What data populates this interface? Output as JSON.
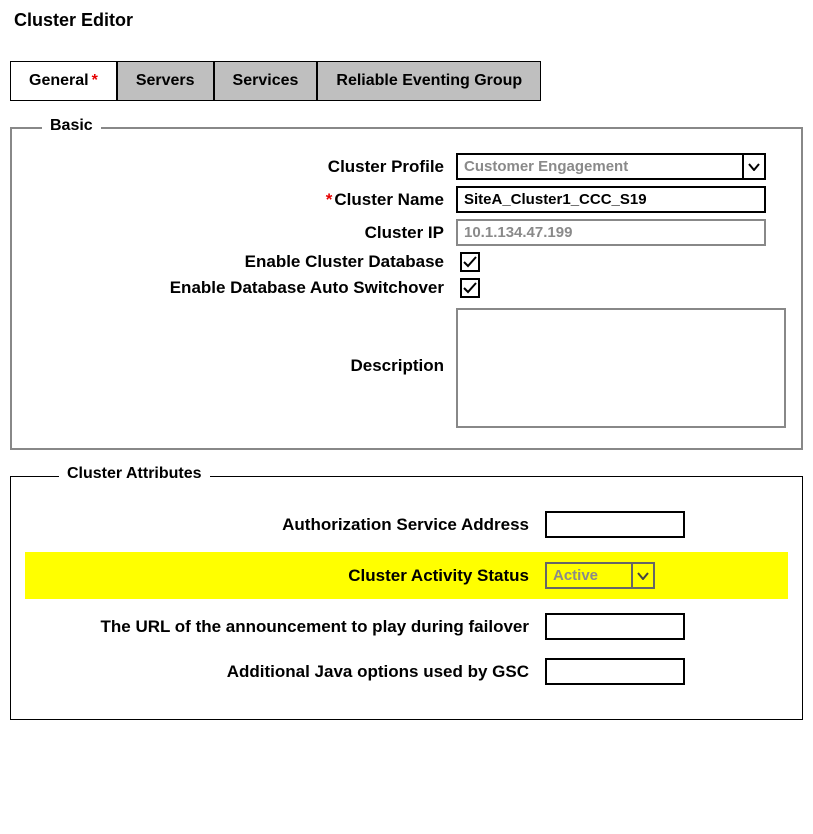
{
  "title": "Cluster Editor",
  "tabs": [
    {
      "label": "General",
      "required": true,
      "active": true
    },
    {
      "label": "Servers",
      "required": false,
      "active": false
    },
    {
      "label": "Services",
      "required": false,
      "active": false
    },
    {
      "label": "Reliable Eventing Group",
      "required": false,
      "active": false
    }
  ],
  "basic": {
    "legend": "Basic",
    "fields": {
      "cluster_profile": {
        "label": "Cluster Profile",
        "value": "Customer Engagement"
      },
      "cluster_name": {
        "label": "Cluster Name",
        "required": true,
        "value": "SiteA_Cluster1_CCC_S19"
      },
      "cluster_ip": {
        "label": "Cluster IP",
        "value": "10.1.134.47.199"
      },
      "enable_db": {
        "label": "Enable Cluster Database",
        "checked": true
      },
      "enable_auto": {
        "label": "Enable Database Auto Switchover",
        "checked": true
      },
      "description": {
        "label": "Description",
        "value": ""
      }
    }
  },
  "attributes": {
    "legend": "Cluster Attributes",
    "rows": {
      "auth_addr": {
        "label": "Authorization Service Address",
        "value": ""
      },
      "activity": {
        "label": "Cluster Activity Status",
        "value": "Active",
        "highlight": true
      },
      "failover_url": {
        "label": "The URL of the announcement to play during failover",
        "value": ""
      },
      "java_opts": {
        "label": "Additional Java options used by GSC",
        "value": ""
      }
    }
  }
}
